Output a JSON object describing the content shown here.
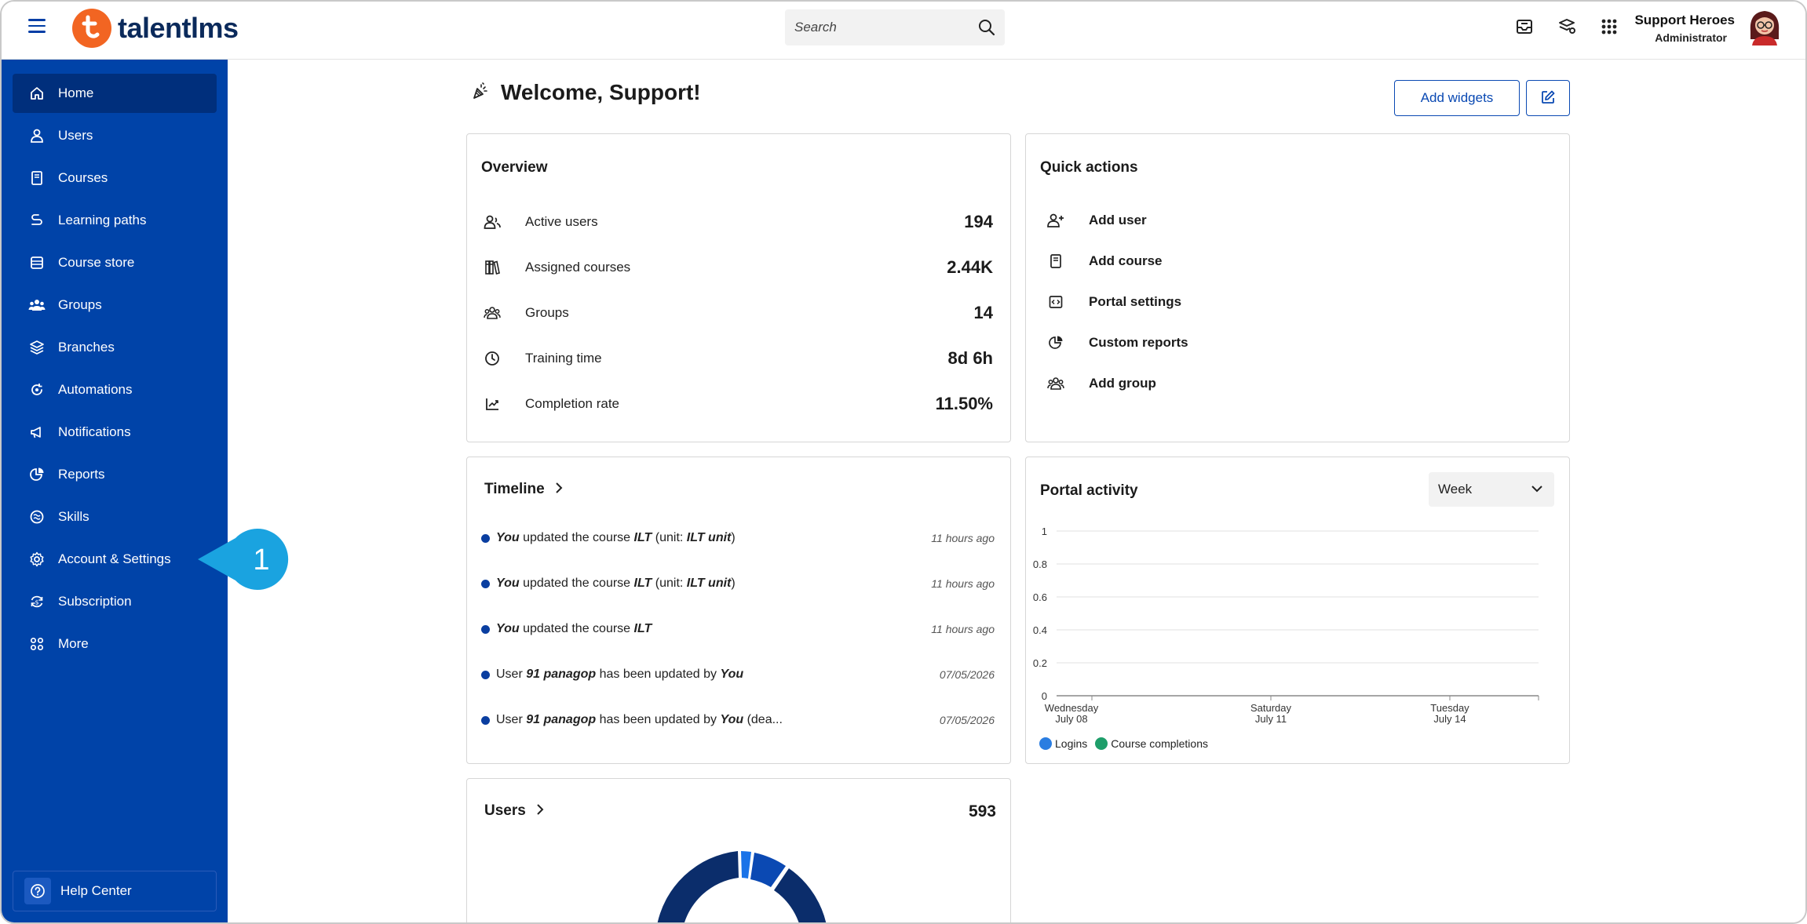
{
  "app": {
    "brand": "talentlms",
    "brand_color": "#f26522",
    "sidebar_color": "#0043a8"
  },
  "search": {
    "placeholder": "Search"
  },
  "header_icons": [
    "inbox-icon",
    "courses-store-icon",
    "apps-grid-icon"
  ],
  "user": {
    "name": "Support Heroes",
    "role": "Administrator"
  },
  "sidebar": {
    "items": [
      {
        "label": "Home",
        "icon": "home-icon",
        "active": true
      },
      {
        "label": "Users",
        "icon": "user-icon"
      },
      {
        "label": "Courses",
        "icon": "book-icon"
      },
      {
        "label": "Learning paths",
        "icon": "path-icon"
      },
      {
        "label": "Course store",
        "icon": "store-icon"
      },
      {
        "label": "Groups",
        "icon": "groups-icon"
      },
      {
        "label": "Branches",
        "icon": "layers-icon"
      },
      {
        "label": "Automations",
        "icon": "automation-icon"
      },
      {
        "label": "Notifications",
        "icon": "megaphone-icon"
      },
      {
        "label": "Reports",
        "icon": "pie-icon"
      },
      {
        "label": "Skills",
        "icon": "skills-icon"
      },
      {
        "label": "Account & Settings",
        "icon": "gear-icon"
      },
      {
        "label": "Subscription",
        "icon": "subscription-icon"
      },
      {
        "label": "More",
        "icon": "more-icon"
      }
    ],
    "help": "Help Center"
  },
  "callout": {
    "number": "1",
    "color": "#1aa3e0"
  },
  "welcome": {
    "title": "Welcome, Support!"
  },
  "toolbar": {
    "add_widgets": "Add widgets"
  },
  "overview": {
    "title": "Overview",
    "rows": [
      {
        "label": "Active users",
        "value": "194",
        "icon": "users-icon"
      },
      {
        "label": "Assigned courses",
        "value": "2.44K",
        "icon": "assigned-courses-icon"
      },
      {
        "label": "Groups",
        "value": "14",
        "icon": "groups-icon"
      },
      {
        "label": "Training time",
        "value": "8d 6h",
        "icon": "clock-icon"
      },
      {
        "label": "Completion rate",
        "value": "11.50%",
        "icon": "trend-icon"
      }
    ]
  },
  "quick_actions": {
    "title": "Quick actions",
    "items": [
      {
        "label": "Add user",
        "icon": "add-user-icon"
      },
      {
        "label": "Add course",
        "icon": "add-course-icon"
      },
      {
        "label": "Portal settings",
        "icon": "code-icon"
      },
      {
        "label": "Custom reports",
        "icon": "pie-icon"
      },
      {
        "label": "Add group",
        "icon": "groups-icon"
      }
    ]
  },
  "timeline": {
    "title": "Timeline",
    "events": [
      {
        "parts": [
          [
            "b",
            "You"
          ],
          [
            "t",
            " updated the course "
          ],
          [
            "b",
            "ILT"
          ],
          [
            "t",
            " (unit: "
          ],
          [
            "b",
            "ILT unit"
          ],
          [
            "t",
            ")"
          ]
        ],
        "time": "11 hours ago"
      },
      {
        "parts": [
          [
            "b",
            "You"
          ],
          [
            "t",
            " updated the course "
          ],
          [
            "b",
            "ILT"
          ],
          [
            "t",
            " (unit: "
          ],
          [
            "b",
            "ILT unit"
          ],
          [
            "t",
            ")"
          ]
        ],
        "time": "11 hours ago"
      },
      {
        "parts": [
          [
            "b",
            "You"
          ],
          [
            "t",
            " updated the course "
          ],
          [
            "b",
            "ILT"
          ]
        ],
        "time": "11 hours ago"
      },
      {
        "parts": [
          [
            "t",
            "User "
          ],
          [
            "b",
            "91 panagop"
          ],
          [
            "t",
            " has been updated by "
          ],
          [
            "b",
            "You"
          ]
        ],
        "time": "07/05/2026"
      },
      {
        "parts": [
          [
            "t",
            "User "
          ],
          [
            "b",
            "91 panagop"
          ],
          [
            "t",
            " has been updated by "
          ],
          [
            "b",
            "You"
          ],
          [
            "t",
            " (dea..."
          ]
        ],
        "time": "07/05/2026"
      }
    ]
  },
  "portal_activity": {
    "title": "Portal activity",
    "period": "Week"
  },
  "chart_data": {
    "type": "line",
    "ylim": [
      0,
      1
    ],
    "yticks": [
      "0",
      "0.2",
      "0.4",
      "0.6",
      "0.8",
      "1"
    ],
    "xticks": [
      {
        "line1": "Wednesday",
        "line2": "July 08"
      },
      {
        "line1": "Saturday",
        "line2": "July 11"
      },
      {
        "line1": "Tuesday",
        "line2": "July 14"
      }
    ],
    "series": [
      {
        "name": "Logins",
        "color": "#2a7de1",
        "values": []
      },
      {
        "name": "Course completions",
        "color": "#1e9e6a",
        "values": []
      }
    ],
    "grid": true,
    "legend": "bottom-left"
  },
  "users_widget": {
    "title": "Users",
    "total": "593",
    "donut_colors": [
      "#0b2d6b",
      "#1a73e8",
      "#0b49b3"
    ]
  }
}
